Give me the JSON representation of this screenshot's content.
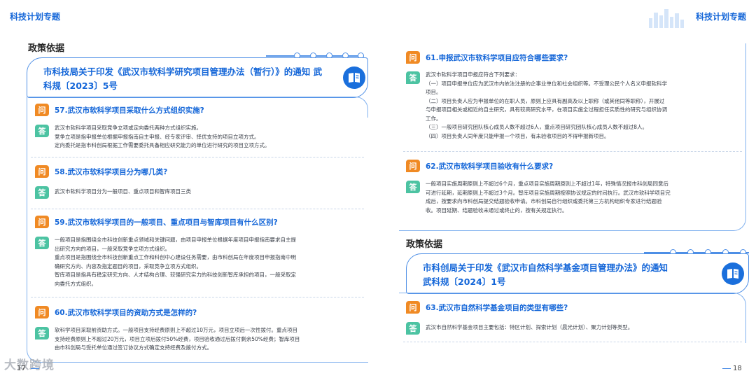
{
  "header": {
    "left_title": "科技计划专题",
    "right_title": "科技计划专题"
  },
  "left": {
    "section_label": "政策依据",
    "policy_title_line1": "市科技局关于印发《武汉市软科学研究项目管理办法（暂行）》的通知 武",
    "policy_title_line2": "科规〔2023〕5号",
    "qa": [
      {
        "q": "57.武汉市软科学项目采取什么方式组织实施?",
        "a": [
          "武汉市软科学项目采取竞争立项或定向委托两种方式组织实施。",
          "竞争立项是指申报单位根据申报指南自主申报、经专家评审、择优支持的项目立项方式。",
          "定向委托是指市科创局根据工作需要委托具备相应研究能力的单位进行研究的项目立项方式。"
        ]
      },
      {
        "q": "58.武汉市软科学项目分为哪几类?",
        "a": [
          "武汉市软科学项目分为一般项目、重点项目和智库项目三类"
        ]
      },
      {
        "q": "59.武汉市软科学项目的一般项目、重点项目与智库项目有什么区别?",
        "a": [
          "一般项目是指围绕全市科技创新重点领域和关键问题，由项目申报单位根据年度项目申报指南要求自主提",
          "出研究方向的项目，一般采取竞争立项方式组织。",
          "重点项目是指围绕全市科技创新重点工作和科创中心建设任务需要，由市科创局在年度项目申报指南中明",
          "确研究方向、内容及指定题目的项目，采取竞争立项方式组织。",
          "智库项目是指具有稳定研究方向、人才结构合理、较强研究实力的科技创新智库承担的项目，一般采取定",
          "向委托方式组织。"
        ]
      },
      {
        "q": "60.武汉市软科学项目的资助方式是怎样的?",
        "a": [
          "软科学项目采取前资助方式。一般项目支持经费原则上不超过10万元，项目立项后一次性拨付。重点项目",
          "支持经费原则上不超过20万元，项目立项后拨付50%经费，项目验收通过后拨付剩余50%经费；智库项目",
          "由市科创局与受托单位通过签订协议方式确定支持经费及拨付方式。"
        ]
      }
    ],
    "page_number": "17"
  },
  "right": {
    "qa_top": [
      {
        "q": "61.申报武汉市软科学项目应符合哪些要求?",
        "a": [
          "武汉市软科学项目申报应符合下列要求：",
          "（一）项目申报单位应为武汉市内依法注册的企事业单位和社会组织等。不受理公民个人名义申报软科学",
          "项目。",
          "（二）项目负责人应为申报单位的在职人员，原则上应具有副高及以上职称（或其他同等职称），开展过",
          "与申报项目相关或相近的自主研究，具有较高研究水平，在项目实施全过程担任实质性的研究与组织协调",
          "工作。",
          "（三）一般项目研究团队核心成员人数不超过6人，重点项目研究团队核心成员人数不超过8人。",
          "（四）项目负责人同年度只能申报一个项目，有未验收项目的不得申报新项目。"
        ]
      },
      {
        "q": "62.武汉市软科学项目验收有什么要求?",
        "a": [
          "一般项目实施周期原则上不超过6个月，重点项目实施周期原则上不超过1年，特殊情况报市科创局同意后",
          "可进行延期，延期原则上不超过3个月。智库项目实施周期按照协议规定的时间执行。武汉市软科学项目完",
          "成后，按要求向市科创局提交结题验收申请。市科创局自行组织或委托第三方机构组织专家进行结题验",
          "收。项目延期、结题验收未通过或终止的，按有关规定执行。"
        ]
      }
    ],
    "section_label": "政策依据",
    "policy_title_line1": "市科创局关于印发《武汉市自然科学基金项目管理办法》的通知",
    "policy_title_line2": "武科规〔2024〕1号",
    "qa_bottom": [
      {
        "q": "63.武汉市自然科学基金项目的类型有哪些?",
        "a": [
          "武汉市自然科学基金项目主要包括：特区计划、探索计划（晨光计划）、聚力计划等类型。"
        ]
      }
    ],
    "page_number": "18"
  },
  "badges": {
    "question": "问",
    "answer": "答"
  },
  "watermark": "大数跨境",
  "colors": {
    "accent_blue": "#1466d8",
    "question_orange": "#f08a24",
    "answer_green": "#4cc3a2",
    "border_blue": "#4e8fe6"
  },
  "icons": [
    "book-icon",
    "skyline-decoration"
  ]
}
